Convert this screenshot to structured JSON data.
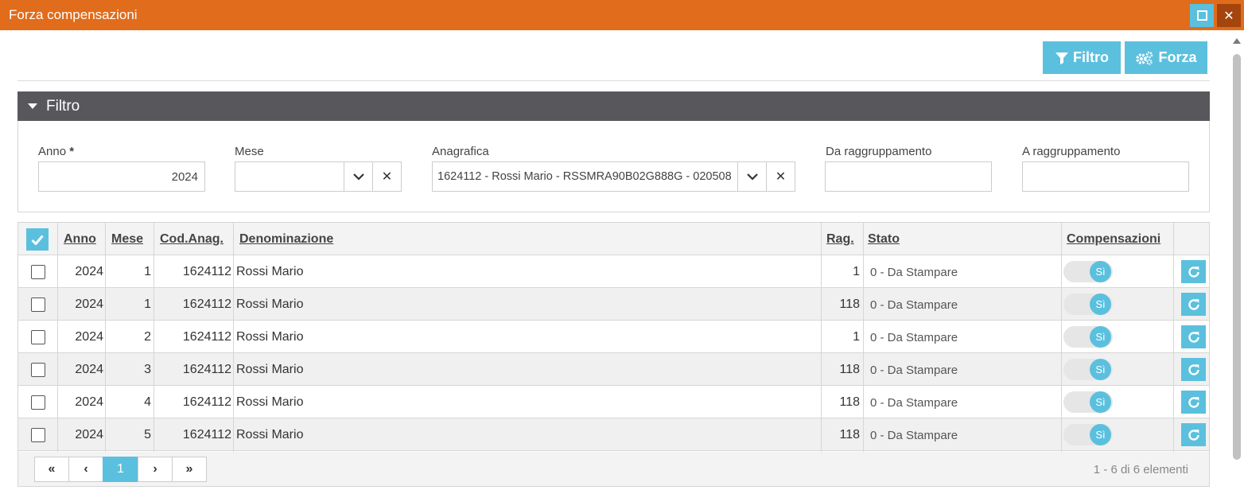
{
  "window": {
    "title": "Forza compensazioni"
  },
  "toolbar": {
    "filtro_label": "Filtro",
    "forza_label": "Forza"
  },
  "filter_panel": {
    "title": "Filtro",
    "anno_label": "Anno",
    "anno_required": "*",
    "anno_value": "2024",
    "mese_label": "Mese",
    "mese_value": "",
    "anagrafica_label": "Anagrafica",
    "anagrafica_value": "1624112 - Rossi Mario - RSSMRA90B02G888G - 020508",
    "da_raggruppamento_label": "Da raggruppamento",
    "da_raggruppamento_value": "",
    "a_raggruppamento_label": "A raggruppamento",
    "a_raggruppamento_value": ""
  },
  "grid": {
    "columns": {
      "anno": "Anno",
      "mese": "Mese",
      "cod_anag": "Cod.Anag.",
      "denominazione": "Denominazione",
      "rag": "Rag.",
      "stato": "Stato",
      "compensazioni": "Compensazioni"
    },
    "rows": [
      {
        "anno": "2024",
        "mese": "1",
        "cod_anag": "1624112",
        "denominazione": "Rossi Mario",
        "rag": "1",
        "stato": "0 - Da Stampare",
        "compensazioni": "Sì"
      },
      {
        "anno": "2024",
        "mese": "1",
        "cod_anag": "1624112",
        "denominazione": "Rossi Mario",
        "rag": "118",
        "stato": "0 - Da Stampare",
        "compensazioni": "Sì"
      },
      {
        "anno": "2024",
        "mese": "2",
        "cod_anag": "1624112",
        "denominazione": "Rossi Mario",
        "rag": "1",
        "stato": "0 - Da Stampare",
        "compensazioni": "Sì"
      },
      {
        "anno": "2024",
        "mese": "3",
        "cod_anag": "1624112",
        "denominazione": "Rossi Mario",
        "rag": "118",
        "stato": "0 - Da Stampare",
        "compensazioni": "Sì"
      },
      {
        "anno": "2024",
        "mese": "4",
        "cod_anag": "1624112",
        "denominazione": "Rossi Mario",
        "rag": "118",
        "stato": "0 - Da Stampare",
        "compensazioni": "Sì"
      },
      {
        "anno": "2024",
        "mese": "5",
        "cod_anag": "1624112",
        "denominazione": "Rossi Mario",
        "rag": "118",
        "stato": "0 - Da Stampare",
        "compensazioni": "Sì"
      }
    ]
  },
  "pager": {
    "first": "«",
    "prev": "‹",
    "current_page": "1",
    "next": "›",
    "last": "»",
    "info": "1 - 6 di 6 elementi"
  },
  "colors": {
    "titlebar": "#e06c1c",
    "accent": "#5bc0de",
    "panel_header": "#58585c"
  }
}
